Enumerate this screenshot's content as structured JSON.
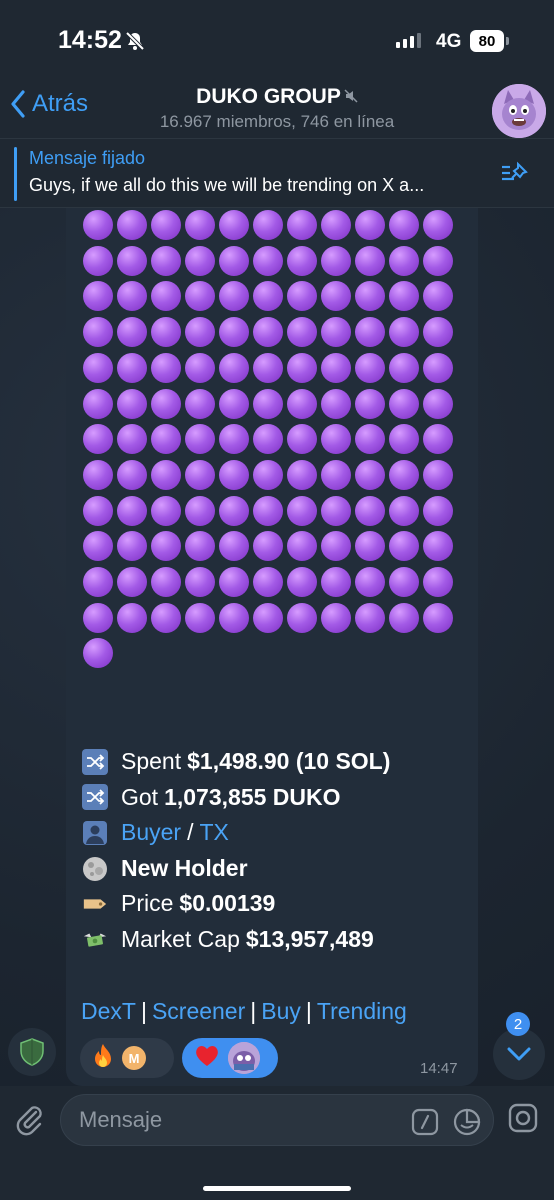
{
  "status_bar": {
    "time": "14:52",
    "network": "4G",
    "battery": "80"
  },
  "nav": {
    "back_label": "Atrás",
    "title": "DUKO GROUP",
    "subtitle": "16.967 miembros, 746 en línea"
  },
  "pinned": {
    "label": "Mensaje fijado",
    "text": "Guys, if we all do this we will be trending on X a..."
  },
  "message": {
    "purple_circle_count": 133,
    "spent_label": "Spent",
    "spent_value": "$1,498.90 (10 SOL)",
    "got_label": "Got",
    "got_value": "1,073,855 DUKO",
    "buyer_link": "Buyer",
    "slash": "/",
    "tx_link": "TX",
    "new_holder": "New Holder",
    "price_label": "Price",
    "price_value": "$0.00139",
    "mcap_label": "Market Cap",
    "mcap_value": "$13,957,489",
    "links": [
      "DexT",
      "Screener",
      "Buy",
      "Trending"
    ],
    "separator": "|",
    "time": "14:47",
    "reaction_m": "M"
  },
  "scroll_badge": "2",
  "input": {
    "placeholder": "Mensaje"
  },
  "colors": {
    "accent": "#3f9ef5",
    "background": "#1e2733",
    "bubble": "#222d3a",
    "purple": "#a35ae6"
  }
}
